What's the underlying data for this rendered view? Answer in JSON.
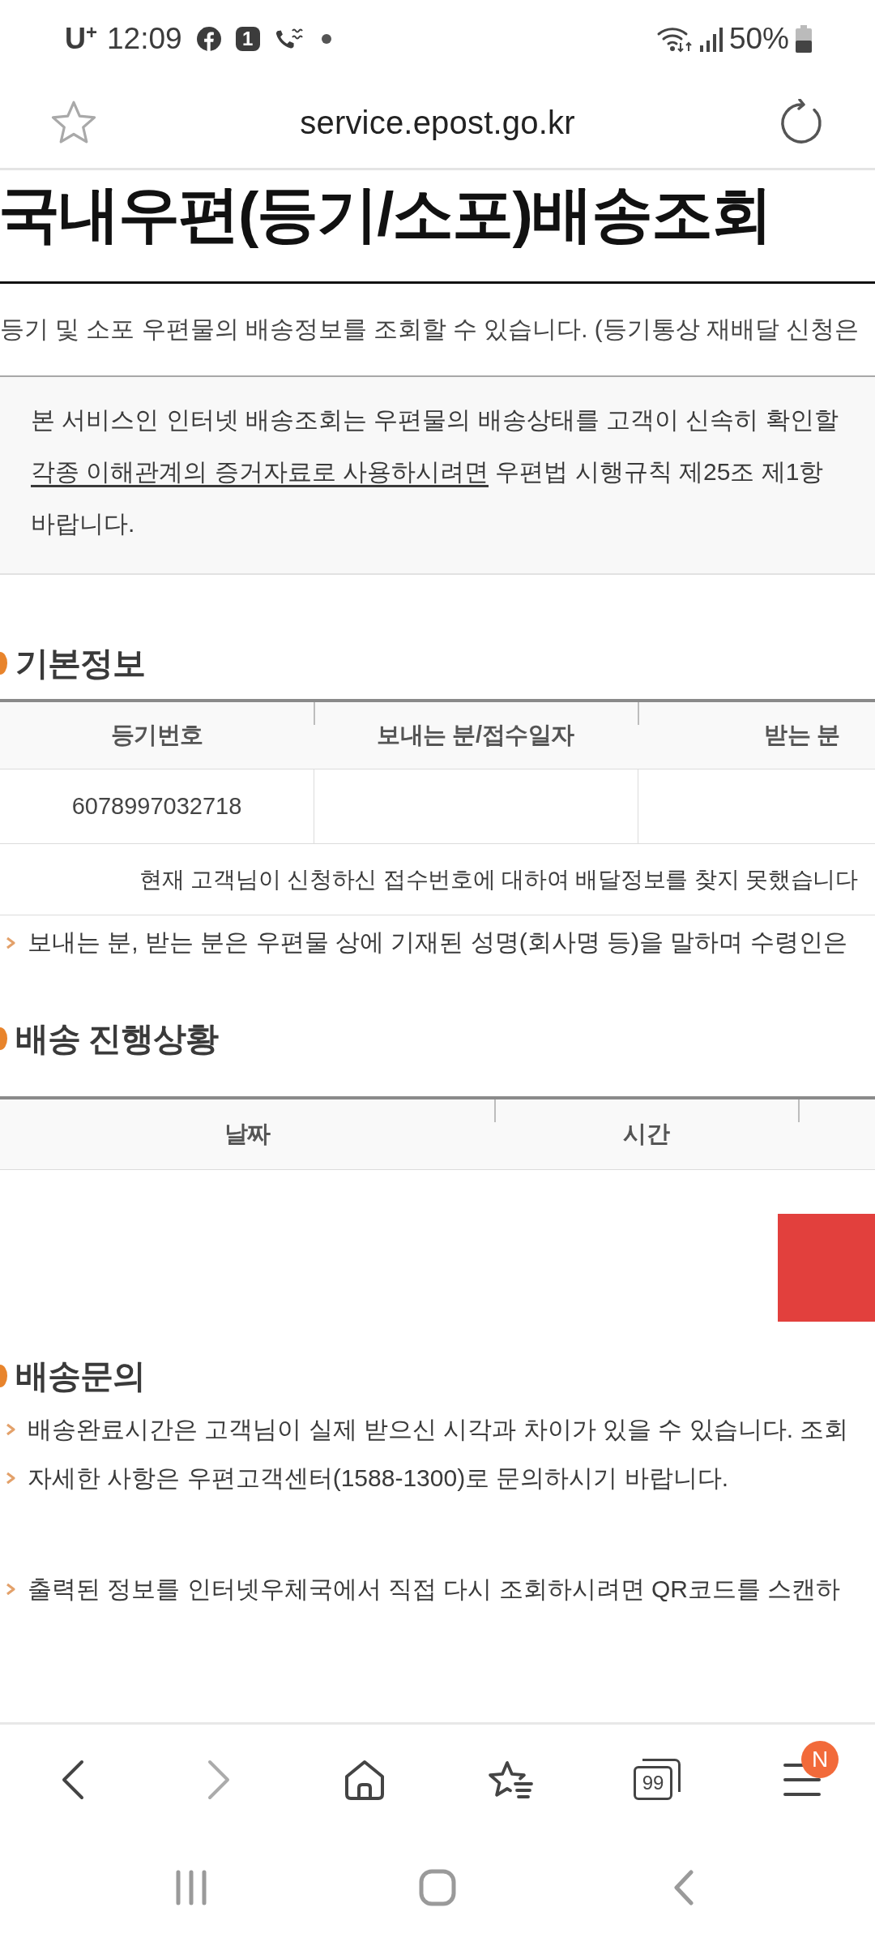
{
  "status_bar": {
    "carrier": "U$^{+}$",
    "time": "12:09",
    "notifications": [
      {
        "kind": "facebook"
      },
      {
        "kind": "app",
        "label": "1"
      },
      {
        "kind": "call"
      },
      {
        "kind": "dot"
      }
    ],
    "battery": "50%"
  },
  "address_bar": {
    "url": "service.epost.go.kr"
  },
  "page": {
    "title": "국내우편(등기/소포)배송조회",
    "description": "등기 및 소포 우편물의 배송정보를 조회할 수 있습니다. (등기통상 재배달 신청은",
    "notice": [
      {
        "text": "본 서비스인 인터넷 배송조회는 우편물의 배송상태를 고객이 신속히 확인할"
      },
      {
        "underlined": "각종 이해관계의 증거자료로 사용하시려면",
        "text": "우편법 시행규칙 제25조 제1항"
      },
      {
        "text": "바랍니다."
      }
    ]
  },
  "basic_info": {
    "heading": "기본정보",
    "columns": [
      "등기번호",
      "보내는 분/접수일자",
      "받는 분"
    ],
    "rows": [
      [
        "6078997032718"
      ]
    ],
    "message": "현재 고객님이 신청하신 접수번호에 대하여 배달정보를 찾지 못했습니다",
    "note": "보내는 분, 받는 분은 우편물 상에 기재된 성명(회사명 등)을 말하며 수령인은"
  },
  "progress": {
    "heading": "배송 진행상황",
    "columns": [
      "날짜",
      "시간"
    ]
  },
  "inquiry": {
    "heading": "배송문의",
    "notes": [
      "배송완료시간은 고객님이 실제 받으신 시각과 차이가 있을 수 있습니다. 조회",
      "자세한 사항은 우편고객센터(1588-1300)로 문의하시기 바랍니다."
    ],
    "qr_note": "출력된 정보를 인터넷우체국에서 직접 다시 조회하시려면 QR코드를 스캔하"
  },
  "browser_toolbar": [
    {
      "kind": "back",
      "disabled": false
    },
    {
      "kind": "forward",
      "disabled": true
    },
    {
      "kind": "home",
      "disabled": false
    },
    {
      "kind": "bookmarks",
      "disabled": false
    },
    {
      "kind": "tabs",
      "label": "99",
      "disabled": false
    },
    {
      "kind": "menu",
      "badge": "N",
      "disabled": false
    }
  ],
  "nav_bar": [
    {
      "kind": "recents"
    },
    {
      "kind": "home"
    },
    {
      "kind": "back"
    }
  ]
}
